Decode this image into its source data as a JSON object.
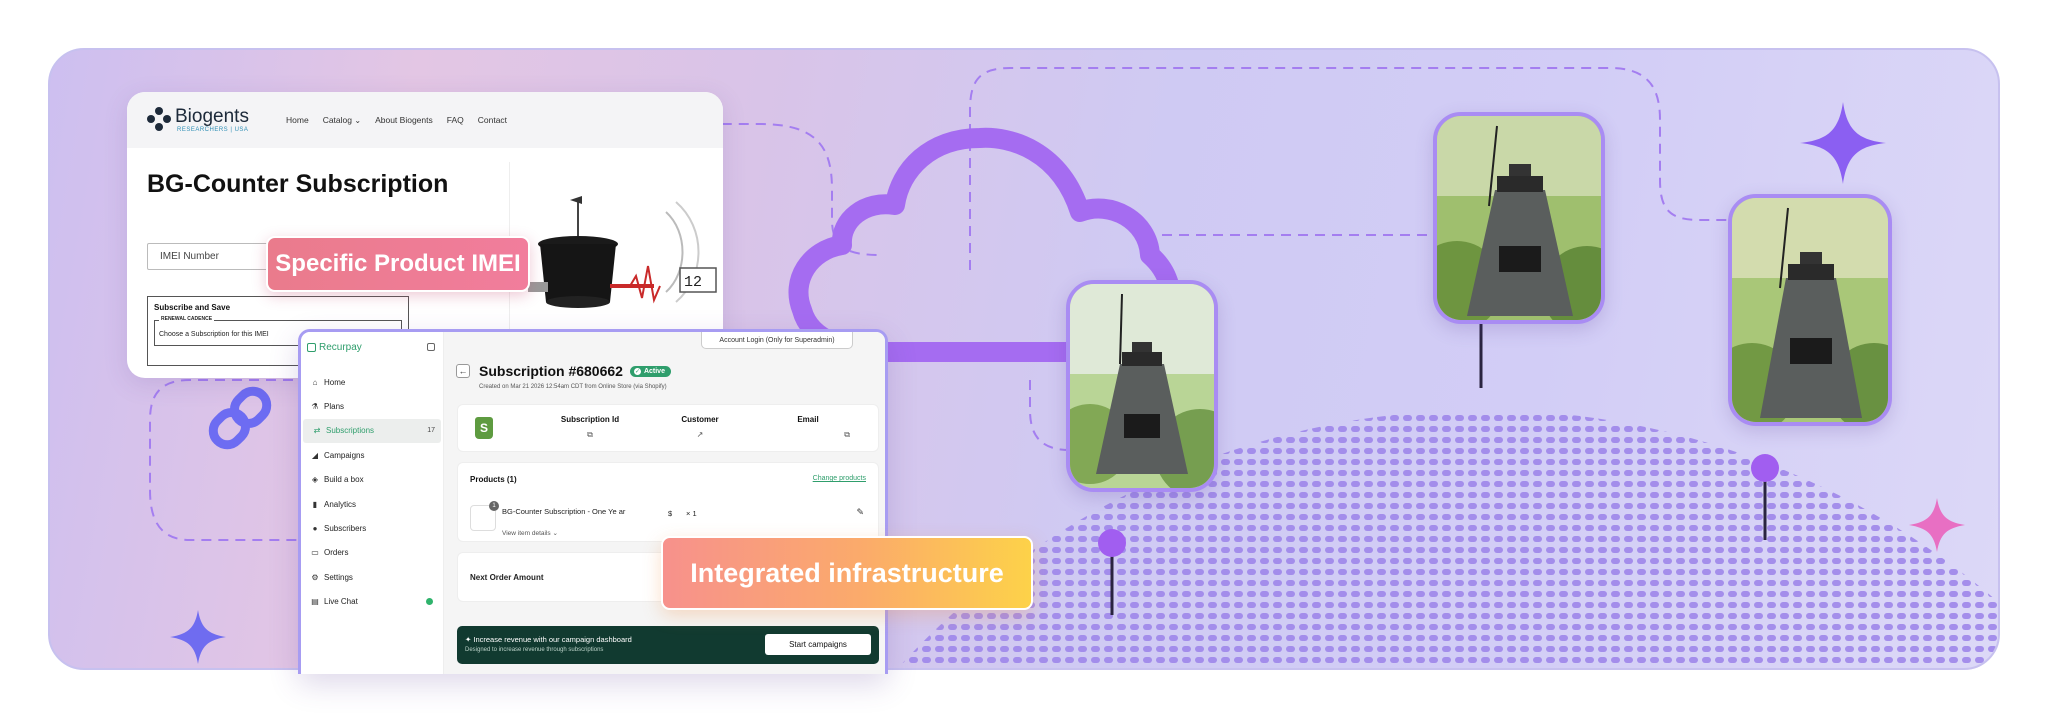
{
  "biogents": {
    "logo_name": "Biogents",
    "logo_sub": "RESEARCHERS | USA",
    "nav": {
      "home": "Home",
      "catalog": "Catalog",
      "about": "About Biogents",
      "faq": "FAQ",
      "contact": "Contact"
    },
    "title": "BG-Counter Subscription",
    "imei_placeholder": "IMEI Number",
    "subscribe_title": "Subscribe and Save",
    "renewal_label": "RENEWAL CADENCE",
    "renewal_value": "Choose a Subscription for this IMEI",
    "counter_display": "12"
  },
  "labels": {
    "imei": "Specific Product IMEI",
    "infra": "Integrated infrastructure"
  },
  "recurpay": {
    "brand": "Recurpay",
    "nav": [
      {
        "label": "Home",
        "icon": "home-icon",
        "glyph": "⌂"
      },
      {
        "label": "Plans",
        "icon": "plans-icon",
        "glyph": "⚗"
      },
      {
        "label": "Subscriptions",
        "icon": "subscriptions-icon",
        "glyph": "⇄",
        "badge": "17",
        "active": true
      },
      {
        "label": "Campaigns",
        "icon": "campaigns-icon",
        "glyph": "◢"
      },
      {
        "label": "Build a box",
        "icon": "box-icon",
        "glyph": "◈"
      },
      {
        "label": "Analytics",
        "icon": "analytics-icon",
        "glyph": "▮"
      },
      {
        "label": "Subscribers",
        "icon": "subscribers-icon",
        "glyph": "●"
      },
      {
        "label": "Orders",
        "icon": "orders-icon",
        "glyph": "▭"
      },
      {
        "label": "Settings",
        "icon": "settings-icon",
        "glyph": "⚙"
      },
      {
        "label": "Live Chat",
        "icon": "chat-icon",
        "glyph": "▤",
        "live": true
      }
    ],
    "account_login": "Account Login (Only for Superadmin)",
    "subscription_title": "Subscription #680662",
    "status": "Active",
    "created": "Created on Mar 21 2026 12:54am CDT from Online Store (via Shopify)",
    "info_cols": {
      "sub_id": "Subscription Id",
      "customer": "Customer",
      "email": "Email"
    },
    "products_title": "Products (1)",
    "change_products": "Change products",
    "product_name": "BG-Counter Subscription - One Ye ar",
    "view_details": "View item details",
    "price": "$",
    "qty": "× 1",
    "thumb_count": "1",
    "next_order": "Next Order Amount",
    "promo_title": "✦ Increase revenue with our campaign dashboard",
    "promo_sub": "Designed to increase revenue through subscriptions",
    "promo_button": "Start campaigns"
  },
  "colors": {
    "brand_green": "#2f9e6c",
    "accent_purple": "#a98cf3",
    "pin_purple": "#a15ef0",
    "sparkle_pink": "#e86fc3",
    "sparkle_blue": "#6f6cf0"
  }
}
